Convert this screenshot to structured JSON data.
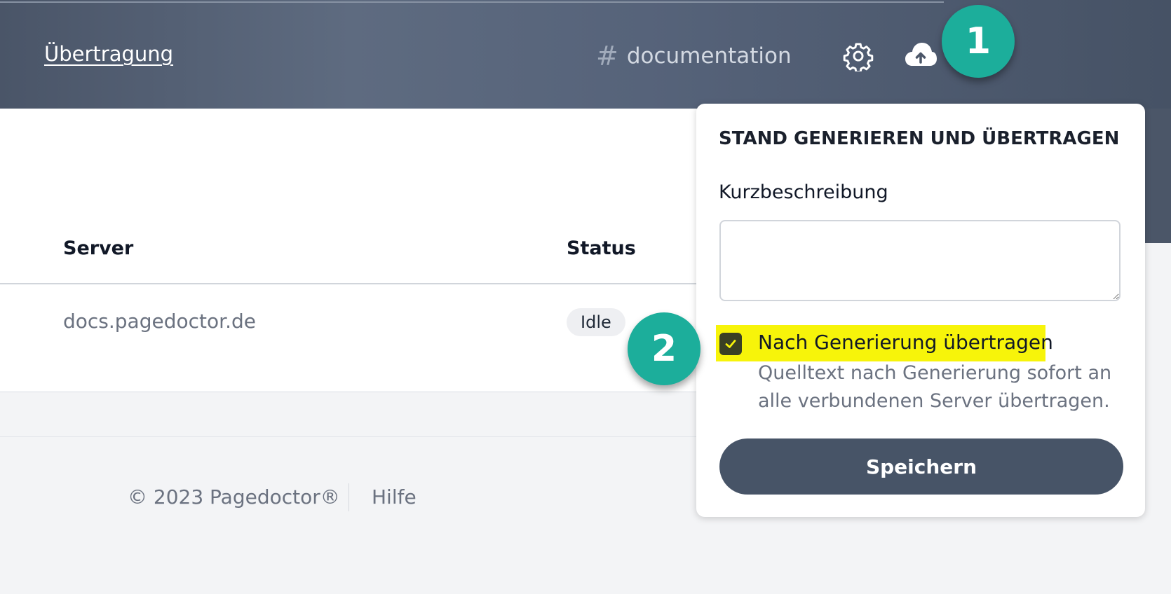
{
  "header": {
    "nav_link": "Übertragung",
    "project_prefix": "#",
    "project_name": "documentation",
    "icons": [
      "gear-icon",
      "cloud-upload-icon"
    ]
  },
  "callouts": {
    "one": "1",
    "two": "2",
    "color": "#1cae9b"
  },
  "table": {
    "columns": [
      "Server",
      "Status"
    ],
    "rows": [
      {
        "server": "docs.pagedoctor.de",
        "status": "Idle"
      }
    ]
  },
  "footer": {
    "copyright": "© 2023 Pagedoctor®",
    "help": "Hilfe"
  },
  "popover": {
    "title": "STAND GENERIEREN UND ÜBERTRAGEN",
    "field_label": "Kurzbeschreibung",
    "field_value": "",
    "checkbox_checked": true,
    "checkbox_label": "Nach Generierung übertragen",
    "checkbox_description": "Quelltext nach Generierung sofort an alle verbundenen Server übertragen.",
    "save_label": "Speichern",
    "highlight_color": "#f7f40a"
  }
}
